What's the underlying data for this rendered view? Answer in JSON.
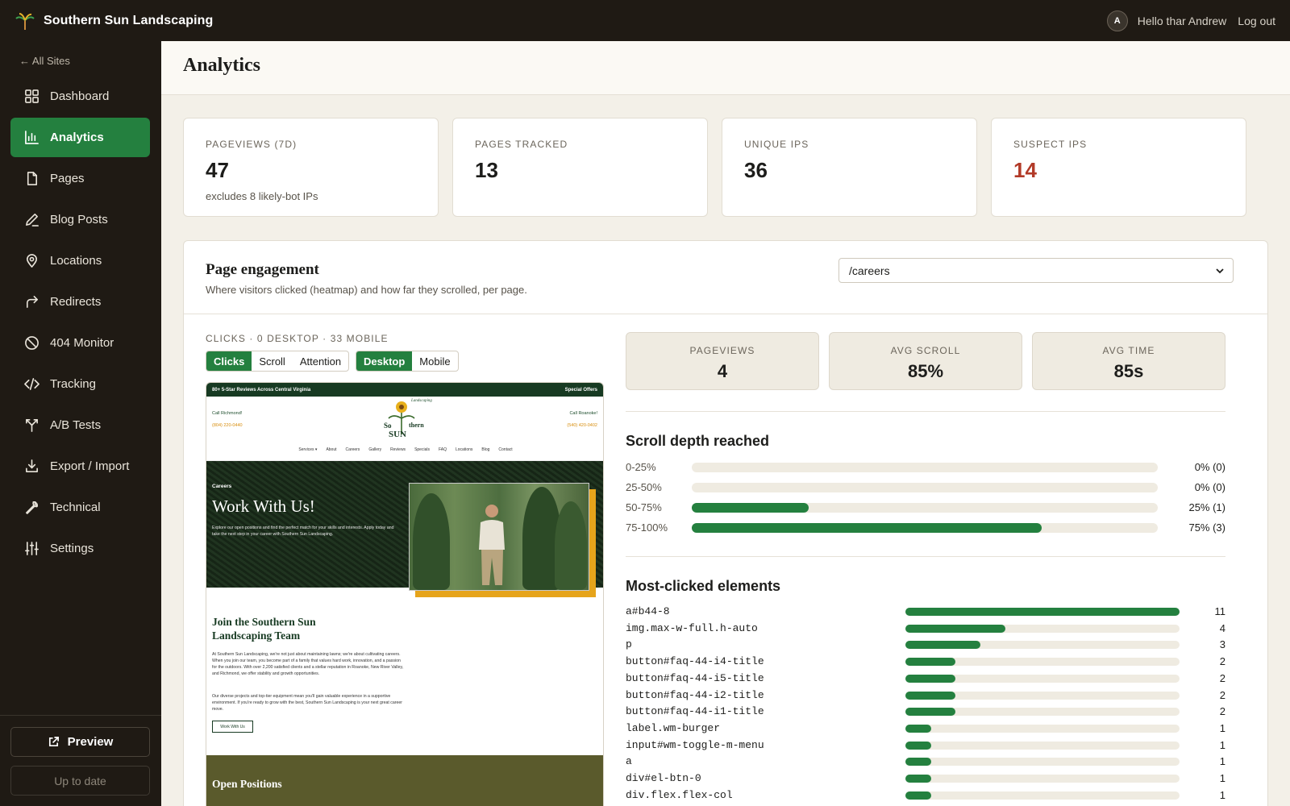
{
  "app": {
    "title": "Southern Sun Landscaping",
    "user_greeting": "Hello thar Andrew",
    "avatar_initial": "A",
    "logout_label": "Log out"
  },
  "sidebar": {
    "back_label": "← All Sites",
    "items": [
      {
        "label": "Dashboard",
        "icon": "dashboard-icon",
        "active": false
      },
      {
        "label": "Analytics",
        "icon": "bar-chart-icon",
        "active": true
      },
      {
        "label": "Pages",
        "icon": "file-icon",
        "active": false
      },
      {
        "label": "Blog Posts",
        "icon": "pencil-icon",
        "active": false
      },
      {
        "label": "Locations",
        "icon": "map-pin-icon",
        "active": false
      },
      {
        "label": "Redirects",
        "icon": "redirect-arrow-icon",
        "active": false
      },
      {
        "label": "404 Monitor",
        "icon": "ban-icon",
        "active": false
      },
      {
        "label": "Tracking",
        "icon": "code-icon",
        "active": false
      },
      {
        "label": "A/B Tests",
        "icon": "split-icon",
        "active": false
      },
      {
        "label": "Export / Import",
        "icon": "download-icon",
        "active": false
      },
      {
        "label": "Technical",
        "icon": "wrench-icon",
        "active": false
      },
      {
        "label": "Settings",
        "icon": "sliders-icon",
        "active": false
      }
    ],
    "preview_label": "Preview",
    "status_label": "Up to date"
  },
  "page": {
    "title": "Analytics"
  },
  "stats": [
    {
      "label": "PAGEVIEWS (7D)",
      "value": "47",
      "note": "excludes 8 likely-bot IPs"
    },
    {
      "label": "PAGES TRACKED",
      "value": "13",
      "note": ""
    },
    {
      "label": "UNIQUE IPS",
      "value": "36",
      "note": ""
    },
    {
      "label": "SUSPECT IPS",
      "value": "14",
      "note": ""
    }
  ],
  "engagement": {
    "title": "Page engagement",
    "subtitle": "Where visitors clicked (heatmap) and how far they scrolled, per page.",
    "selected_page": "/careers",
    "clicks_label": "CLICKS · 0 DESKTOP · 33 MOBILE",
    "mode_tabs": [
      "Clicks",
      "Scroll",
      "Attention"
    ],
    "active_mode": "Clicks",
    "device_tabs": [
      "Desktop",
      "Mobile"
    ],
    "active_device": "Desktop",
    "metrics": [
      {
        "label": "PAGEVIEWS",
        "value": "4"
      },
      {
        "label": "AVG SCROLL",
        "value": "85%"
      },
      {
        "label": "AVG TIME",
        "value": "85s"
      }
    ],
    "scroll_title": "Scroll depth reached",
    "scroll_depth": [
      {
        "range": "0-25%",
        "percent": 0,
        "display": "0% (0)"
      },
      {
        "range": "25-50%",
        "percent": 0,
        "display": "0% (0)"
      },
      {
        "range": "50-75%",
        "percent": 25,
        "display": "25% (1)"
      },
      {
        "range": "75-100%",
        "percent": 75,
        "display": "75% (3)"
      }
    ],
    "clicked_title": "Most-clicked elements",
    "clicked_elements": [
      {
        "selector": "a#b44-8",
        "count": 11
      },
      {
        "selector": "img.max-w-full.h-auto",
        "count": 4
      },
      {
        "selector": "p",
        "count": 3
      },
      {
        "selector": "button#faq-44-i4-title",
        "count": 2
      },
      {
        "selector": "button#faq-44-i5-title",
        "count": 2
      },
      {
        "selector": "button#faq-44-i2-title",
        "count": 2
      },
      {
        "selector": "button#faq-44-i1-title",
        "count": 2
      },
      {
        "selector": "label.wm-burger",
        "count": 1
      },
      {
        "selector": "input#wm-toggle-m-menu",
        "count": 1
      },
      {
        "selector": "a",
        "count": 1
      },
      {
        "selector": "div#el-btn-0",
        "count": 1
      },
      {
        "selector": "div.flex.flex-col",
        "count": 1
      }
    ]
  },
  "preview_page": {
    "topbar_left": "80+ 5-Star Reviews Across Central Virginia",
    "topbar_right": "Special Offers",
    "call_left": "Call Richmond!",
    "phone_left": "(804) 220-0440",
    "call_right": "Call Roanoke!",
    "phone_right": "(540) 420-0402",
    "logo_text_top": "So",
    "logo_text_mid": "thern",
    "logo_text_bottom": "SUN",
    "logo_script": "Landscaping",
    "nav": [
      "Services ▾",
      "About",
      "Careers",
      "Gallery",
      "Reviews",
      "Specials",
      "FAQ",
      "Locations",
      "Blog",
      "Contact"
    ],
    "hero_kicker": "Careers",
    "hero_title": "Work With Us!",
    "hero_text": "Explore our open positions and find the perfect match for your skills and interests. Apply today and take the next step in your career with Southern Sun Landscaping.",
    "join_title": "Join the Southern Sun Landscaping Team",
    "para1": "At Southern Sun Landscaping, we're not just about maintaining lawns; we're about cultivating careers. When you join our team, you become part of a family that values hard work, innovation, and a passion for the outdoors. With over 2,200 satisfied clients and a stellar reputation in Roanoke, New River Valley, and Richmond, we offer stability and growth opportunities.",
    "para2": "Our diverse projects and top-tier equipment mean you'll gain valuable experience in a supportive environment. If you're ready to grow with the best, Southern Sun Landscaping is your next great career move.",
    "cta": "Work With Us",
    "open_title": "Open Positions"
  },
  "colors": {
    "accent": "#24803f",
    "sidebar_bg": "#1f1a14",
    "warning": "#b23a28",
    "track": "#efebe1"
  }
}
